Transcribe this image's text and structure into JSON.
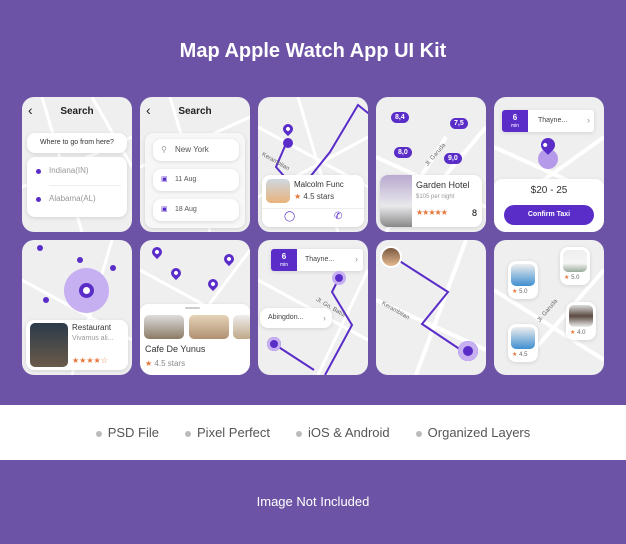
{
  "title": "Map Apple Watch App UI Kit",
  "map_labels": {
    "street1": "Kerambitan",
    "street2": "Jl. Garuda",
    "street3": "Jl. Gn. Batur"
  },
  "screen1": {
    "header": "Search",
    "prompt": "Where to go from here?",
    "from": "Indiana(IN)",
    "to": "Alabama(AL)"
  },
  "screen2": {
    "header": "Search",
    "search_value": "New York",
    "date1": "11 Aug",
    "date2": "18 Aug"
  },
  "screen3": {
    "name": "Malcolm Func",
    "rating": "4.5 stars"
  },
  "screen4": {
    "prices": [
      "8,4",
      "7,5",
      "8,0",
      "9,0"
    ],
    "hotel": "Garden Hotel",
    "price": "$105 per night",
    "score": "8",
    "stars": 5
  },
  "screen5": {
    "minutes": "6",
    "min_unit": "min",
    "destination": "Thayne...",
    "fare": "$20 - 25",
    "confirm": "Confirm Taxi"
  },
  "screen6": {
    "name": "Restaurant",
    "desc": "Vivamus ali...",
    "stars": 4
  },
  "screen7": {
    "name": "Cafe De Yunus",
    "rating": "4.5 stars"
  },
  "screen8": {
    "minutes": "6",
    "min_unit": "min",
    "destination": "Thayne...",
    "origin": "Abingdon..."
  },
  "screen10": {
    "ratings": [
      "5.0",
      "5.0",
      "4.0",
      "4.5"
    ]
  },
  "features": [
    "PSD File",
    "Pixel Perfect",
    "iOS & Android",
    "Organized Layers"
  ],
  "footer": "Image Not Included",
  "colors": {
    "background": "#6c53a6",
    "accent": "#5a2dc8",
    "star": "#e8763a"
  }
}
